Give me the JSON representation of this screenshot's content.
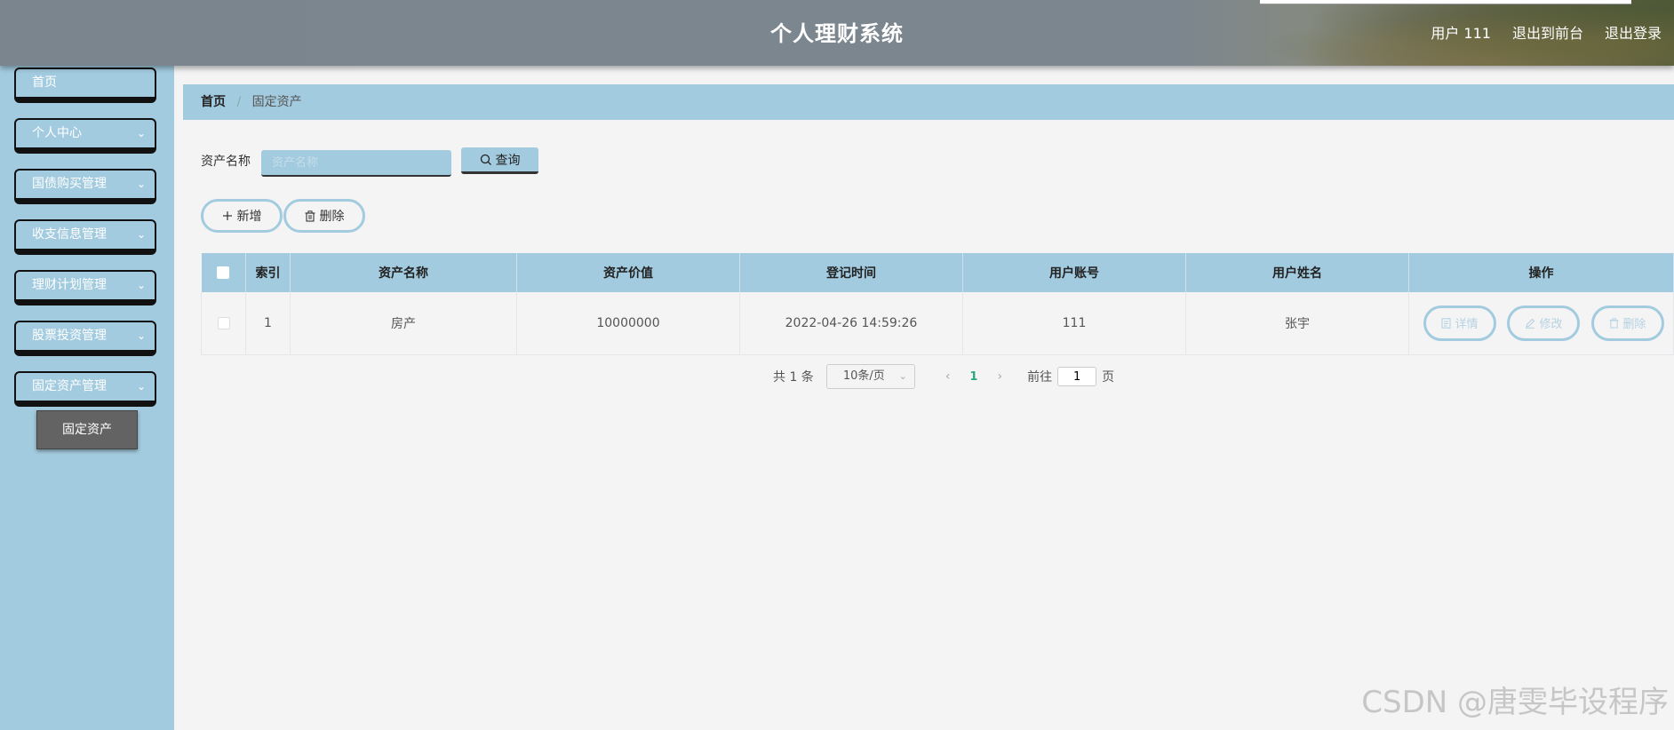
{
  "header": {
    "title": "个人理财系统",
    "user": "用户 111",
    "front": "退出到前台",
    "logout": "退出登录"
  },
  "sidebar": {
    "items": [
      {
        "label": "首页",
        "has_arrow": false
      },
      {
        "label": "个人中心",
        "has_arrow": true
      },
      {
        "label": "国债购买管理",
        "has_arrow": true
      },
      {
        "label": "收支信息管理",
        "has_arrow": true
      },
      {
        "label": "理财计划管理",
        "has_arrow": true
      },
      {
        "label": "股票投资管理",
        "has_arrow": true
      },
      {
        "label": "固定资产管理",
        "has_arrow": true
      }
    ],
    "submenu": "固定资产"
  },
  "breadcrumb": {
    "home": "首页",
    "separator": "/",
    "current": "固定资产"
  },
  "search": {
    "label": "资产名称",
    "placeholder": "资产名称",
    "button": "查询"
  },
  "actions": {
    "add": "新增",
    "delete": "删除"
  },
  "table": {
    "columns": [
      "索引",
      "资产名称",
      "资产价值",
      "登记时间",
      "用户账号",
      "用户姓名",
      "操作"
    ],
    "rows": [
      {
        "index": "1",
        "name": "房产",
        "value": "10000000",
        "time": "2022-04-26 14:59:26",
        "account": "111",
        "username": "张宇"
      }
    ],
    "ops": {
      "detail": "详情",
      "edit": "修改",
      "delete": "删除"
    }
  },
  "pagination": {
    "total": "共 1 条",
    "page_size": "10条/页",
    "current_page": "1",
    "goto_label": "前往",
    "goto_value": "1",
    "page_unit": "页"
  },
  "watermark": "CSDN @唐雯毕设程序",
  "colors": {
    "accent": "#a3cbdf",
    "header": "#7b858e",
    "active_page": "#2ea77a"
  }
}
